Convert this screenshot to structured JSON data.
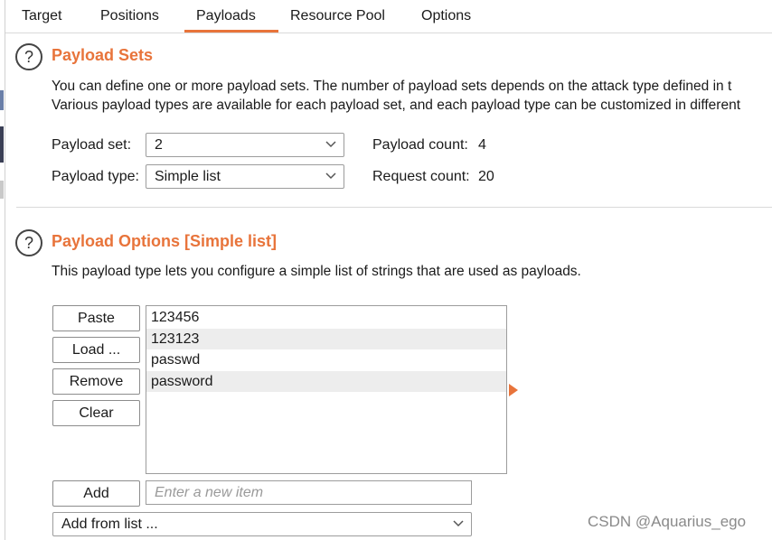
{
  "tabs": [
    {
      "label": "Target"
    },
    {
      "label": "Positions"
    },
    {
      "label": "Payloads"
    },
    {
      "label": "Resource Pool"
    },
    {
      "label": "Options"
    }
  ],
  "active_tab": "Payloads",
  "payload_sets": {
    "title": "Payload Sets",
    "description_line1": "You can define one or more payload sets. The number of payload sets depends on the attack type defined in t",
    "description_line2": "Various payload types are available for each payload set, and each payload type can be customized in different",
    "payload_set_label": "Payload set:",
    "payload_set_value": "2",
    "payload_type_label": "Payload type:",
    "payload_type_value": "Simple list",
    "payload_count_label": "Payload count:",
    "payload_count_value": "4",
    "request_count_label": "Request count:",
    "request_count_value": "20"
  },
  "payload_options": {
    "title": "Payload Options [Simple list]",
    "description": "This payload type lets you configure a simple list of strings that are used as payloads.",
    "buttons": {
      "paste": "Paste",
      "load": "Load ...",
      "remove": "Remove",
      "clear": "Clear",
      "add": "Add"
    },
    "items": [
      "123456",
      "123123",
      "passwd",
      "password"
    ],
    "new_item_placeholder": "Enter a new item",
    "add_from_list": "Add from list ..."
  },
  "help_icon_glyph": "?",
  "watermark": "CSDN @Aquarius_ego",
  "colors": {
    "accent": "#e8743b",
    "text": "#1a1a1a",
    "border": "#9c9c9c",
    "alt_row": "#ededed"
  }
}
